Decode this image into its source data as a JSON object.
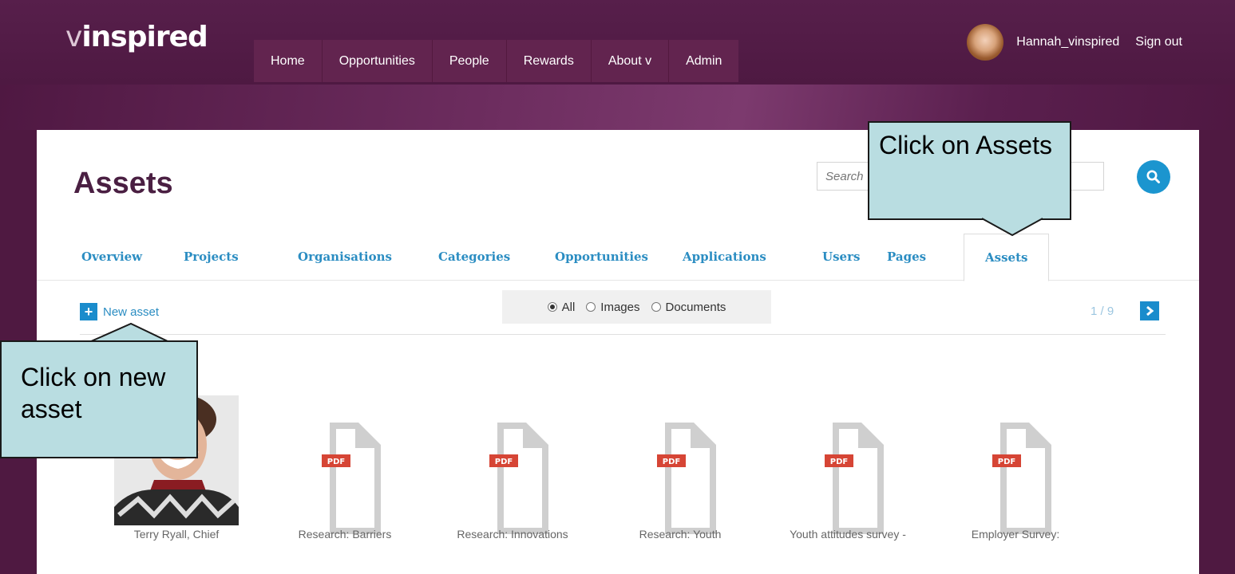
{
  "header": {
    "logo_v": "v",
    "logo_text": "inspired",
    "nav": [
      "Home",
      "Opportunities",
      "People",
      "Rewards",
      "About v",
      "Admin"
    ],
    "username": "Hannah_vinspired",
    "signout": "Sign out"
  },
  "page": {
    "title": "Assets",
    "search_placeholder": "Search"
  },
  "tabs": [
    "Overview",
    "Projects",
    "Organisations",
    "Categories",
    "Opportunities",
    "Applications",
    "Users",
    "Pages",
    "Assets"
  ],
  "active_tab": "Assets",
  "toolbar": {
    "new_asset": "New asset",
    "filter": {
      "options": [
        "All",
        "Images",
        "Documents"
      ],
      "selected": "All"
    },
    "pagination": "1 / 9"
  },
  "assets": [
    {
      "caption": "Terry Ryall, Chief",
      "type": "image"
    },
    {
      "caption": "Research: Barriers",
      "type": "pdf"
    },
    {
      "caption": "Research: Innovations",
      "type": "pdf"
    },
    {
      "caption": "Research: Youth",
      "type": "pdf"
    },
    {
      "caption": "Youth attitudes survey -",
      "type": "pdf"
    },
    {
      "caption": "Employer Survey:",
      "type": "pdf"
    }
  ],
  "pdf_badge": "PDF",
  "callouts": {
    "assets": "Click on Assets",
    "new_asset": "Click on new asset"
  },
  "colors": {
    "brand_purple": "#4d1a40",
    "link_blue": "#2b8dc2",
    "button_blue": "#1a8ccc",
    "pdf_red": "#d64535",
    "callout_bg": "#b9dde1"
  }
}
